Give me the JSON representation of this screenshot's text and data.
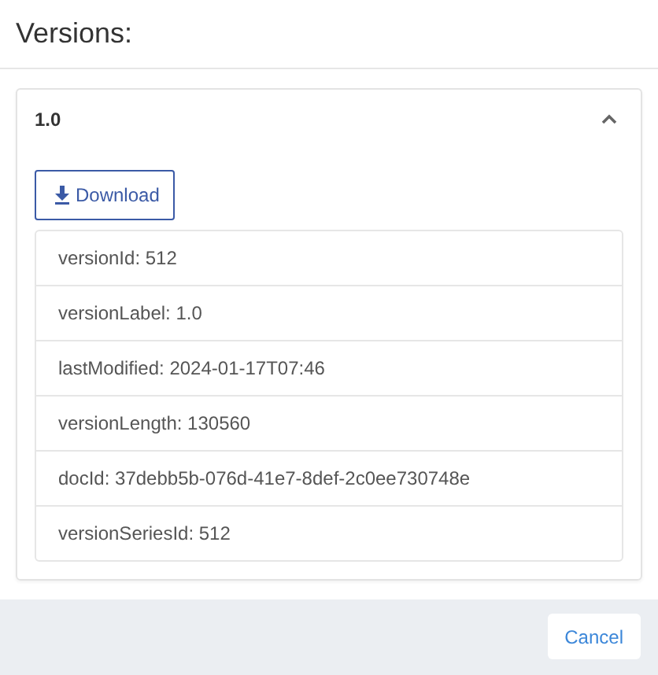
{
  "title": "Versions:",
  "versions": [
    {
      "label": "1.0",
      "expanded": true,
      "download": "Download",
      "properties": [
        "versionId: 512",
        "versionLabel: 1.0",
        "lastModified: 2024-01-17T07:46",
        "versionLength: 130560",
        "docId: 37debb5b-076d-41e7-8def-2c0ee730748e",
        "versionSeriesId: 512"
      ]
    }
  ],
  "footer": {
    "cancel": "Cancel"
  }
}
